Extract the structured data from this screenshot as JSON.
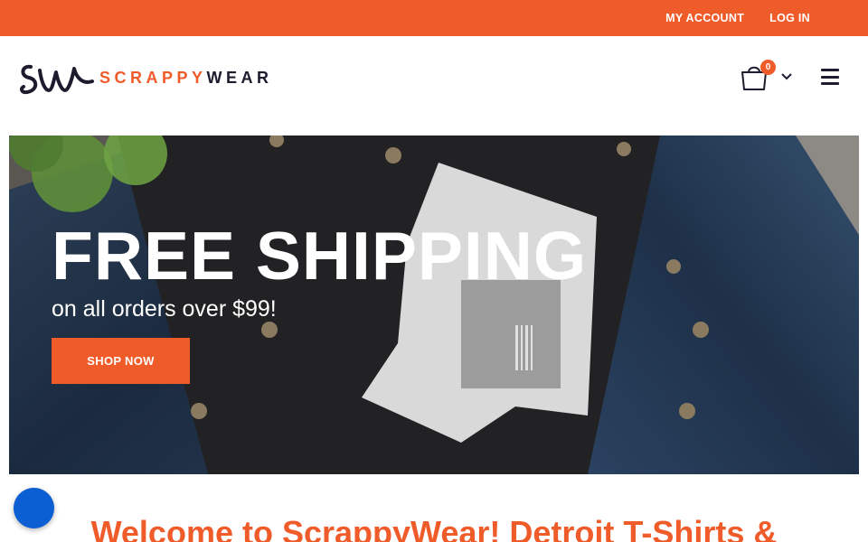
{
  "topbar": {
    "my_account": "MY ACCOUNT",
    "log_in": "LOG IN",
    "background": "#f05b2a"
  },
  "header": {
    "logo_mark": "SW",
    "logo_word_1": "SCRAPPY",
    "logo_word_2": "WEAR",
    "cart_count": "0",
    "cart_icon": "shopping-bag-icon",
    "menu_icon": "hamburger-menu-icon"
  },
  "hero": {
    "title": "FREE SHIPPING",
    "subtitle": "on all orders over $99!",
    "button_label": "SHOP NOW"
  },
  "main": {
    "welcome_heading": "Welcome to ScrappyWear! Detroit T-Shirts &"
  },
  "chat": {
    "icon": "chat-bubble-icon",
    "color": "#0b5fd3"
  },
  "colors": {
    "accent": "#f05b2a",
    "dark": "#1c1c2e"
  }
}
